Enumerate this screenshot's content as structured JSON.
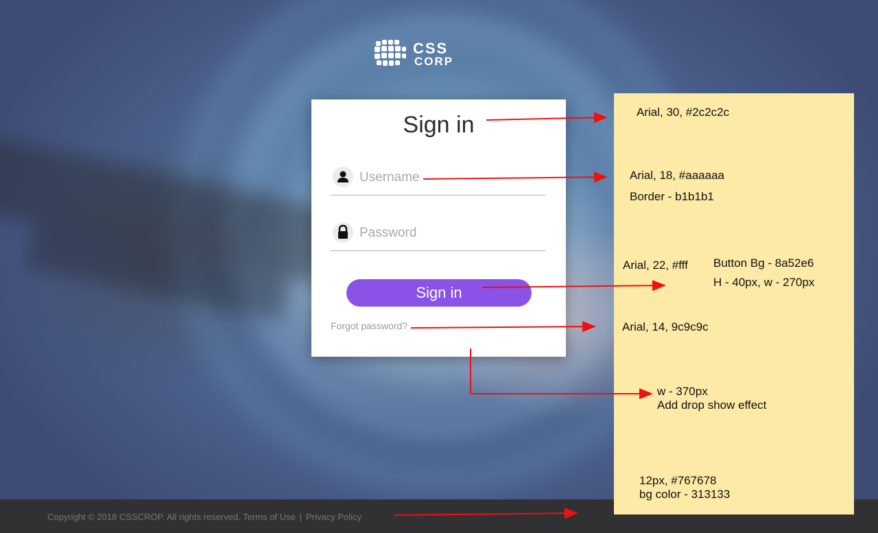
{
  "logo": {
    "line1": "CSS",
    "line2": "CORP"
  },
  "signin": {
    "title": "Sign in",
    "username_placeholder": "Username",
    "password_placeholder": "Password",
    "button_label": "Sign in",
    "forgot_link": "Forgot password?"
  },
  "footer": {
    "copyright": "Copyright © 2018 CSSCROP. All rights reserved.",
    "terms": "Terms of Use",
    "separator": "|",
    "privacy": "Privacy Policy"
  },
  "annotations": {
    "title_spec": "Arial, 30, #2c2c2c",
    "input_spec": "Arial, 18, #aaaaaa",
    "input_border": "Border - b1b1b1",
    "button_font": "Arial, 22, #fff",
    "button_bg": "Button Bg - 8a52e6",
    "button_size": "H - 40px, w - 270px",
    "link_spec": "Arial, 14, 9c9c9c",
    "card_width": "w - 370px",
    "card_shadow": "Add drop show effect",
    "footer_font": "12px, #767678",
    "footer_bg": "bg color - 313133"
  },
  "colors": {
    "button": "#8a52e6",
    "footer_bg": "#313133",
    "note_bg": "#fdeaa7",
    "arrow": "#ee1111"
  }
}
